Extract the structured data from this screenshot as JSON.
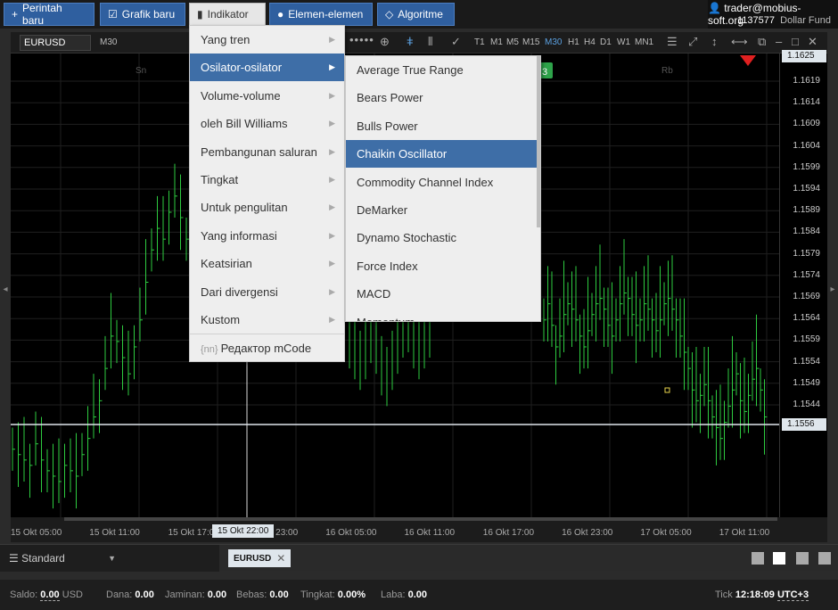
{
  "toolbar": {
    "new_order": "Perintah baru",
    "new_chart": "Grafik baru",
    "indicators": "Indikator",
    "elements": "Elemen-elemen",
    "algorithms": "Algoritme"
  },
  "account": {
    "user": "trader@mobius-soft.org",
    "id": "1137577",
    "fund": "Dollar Fund"
  },
  "chart": {
    "symbol": "EURUSD",
    "timeframe": "M30",
    "timeframes": [
      "T1",
      "M1",
      "M5",
      "M15",
      "M30",
      "H1",
      "H4",
      "D1",
      "W1",
      "MN1"
    ],
    "selected_timeframe": "M30",
    "day_labels": [
      "Sn",
      "Rb"
    ],
    "price_labels": [
      "1.1619",
      "1.1614",
      "1.1609",
      "1.1604",
      "1.1599",
      "1.1594",
      "1.1589",
      "1.1584",
      "1.1579",
      "1.1574",
      "1.1569",
      "1.1564",
      "1.1559",
      "1.1554",
      "1.1549",
      "1.1544"
    ],
    "price_top": "1.1625",
    "price_current": "1.1556",
    "time_labels": [
      "15 Okt 05:00",
      "15 Okt 11:00",
      "15 Okt 17:00",
      "15 Okt 23:00",
      "16 Okt 05:00",
      "16 Okt 11:00",
      "16 Okt 17:00",
      "16 Okt 23:00",
      "17 Okt 05:00",
      "17 Okt 11:00"
    ],
    "time_cursor": "15 Okt 22:00",
    "badge": "3",
    "up_color": "#2ecc40",
    "accent_color": "#3e6ea7"
  },
  "menu1": {
    "items": [
      {
        "label": "Yang tren"
      },
      {
        "label": "Osilator-osilator"
      },
      {
        "label": "Volume-volume"
      },
      {
        "label": "oleh Bill Williams"
      },
      {
        "label": "Pembangunan saluran"
      },
      {
        "label": "Tingkat"
      },
      {
        "label": "Untuk pengulitan"
      },
      {
        "label": "Yang informasi"
      },
      {
        "label": "Keatsirian"
      },
      {
        "label": "Dari divergensi"
      },
      {
        "label": "Kustom"
      }
    ],
    "code_editor": "Редактор mCode",
    "code_icon": "{nn}"
  },
  "menu2": {
    "items": [
      {
        "label": "Average True Range"
      },
      {
        "label": "Bears Power"
      },
      {
        "label": "Bulls Power"
      },
      {
        "label": "Chaikin Oscillator"
      },
      {
        "label": "Commodity Channel Index"
      },
      {
        "label": "DeMarker"
      },
      {
        "label": "Dynamo Stochastic"
      },
      {
        "label": "Force Index"
      },
      {
        "label": "MACD"
      },
      {
        "label": "Momentum"
      }
    ]
  },
  "bottom": {
    "layout": "Standard",
    "tab": "EURUSD"
  },
  "status": {
    "saldo_label": "Saldo:",
    "saldo_value": "0.00",
    "saldo_currency": "USD",
    "dana_label": "Dana:",
    "dana_value": "0.00",
    "jaminan_label": "Jaminan:",
    "jaminan_value": "0.00",
    "bebas_label": "Bebas:",
    "bebas_value": "0.00",
    "tingkat_label": "Tingkat:",
    "tingkat_value": "0.00%",
    "laba_label": "Laba:",
    "laba_value": "0.00",
    "tick_label": "Tick",
    "time": "12:18:09",
    "tz": "UTC+3"
  }
}
